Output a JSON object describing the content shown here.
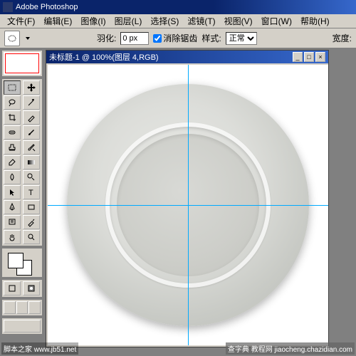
{
  "app": {
    "title": "Adobe Photoshop"
  },
  "menu": {
    "file": "文件(F)",
    "edit": "编辑(E)",
    "image": "图像(I)",
    "layer": "图层(L)",
    "select": "选择(S)",
    "filter": "滤镜(T)",
    "view": "视图(V)",
    "window": "窗口(W)",
    "help": "帮助(H)"
  },
  "options": {
    "feather_label": "羽化:",
    "feather_value": "0 px",
    "antialias_label": "消除锯齿",
    "antialias_checked": true,
    "style_label": "样式:",
    "style_value": "正常",
    "width_label": "宽度:"
  },
  "document": {
    "title": "未标题-1 @ 100%(图层 4,RGB)"
  },
  "watermarks": {
    "left": "脚本之家\nwww.jb51.net",
    "right": "查字典 教程网\njiaocheng.chazidian.com"
  },
  "tools": [
    {
      "name": "marquee-rect",
      "active": true
    },
    {
      "name": "marquee-ellipse"
    },
    {
      "name": "lasso"
    },
    {
      "name": "magic-wand"
    },
    {
      "name": "crop"
    },
    {
      "name": "slice"
    },
    {
      "name": "healing"
    },
    {
      "name": "brush"
    },
    {
      "name": "stamp"
    },
    {
      "name": "history-brush"
    },
    {
      "name": "eraser"
    },
    {
      "name": "gradient"
    },
    {
      "name": "blur"
    },
    {
      "name": "dodge"
    },
    {
      "name": "path-select"
    },
    {
      "name": "type"
    },
    {
      "name": "pen"
    },
    {
      "name": "shape"
    },
    {
      "name": "notes"
    },
    {
      "name": "eyedropper"
    },
    {
      "name": "hand"
    },
    {
      "name": "zoom"
    }
  ]
}
